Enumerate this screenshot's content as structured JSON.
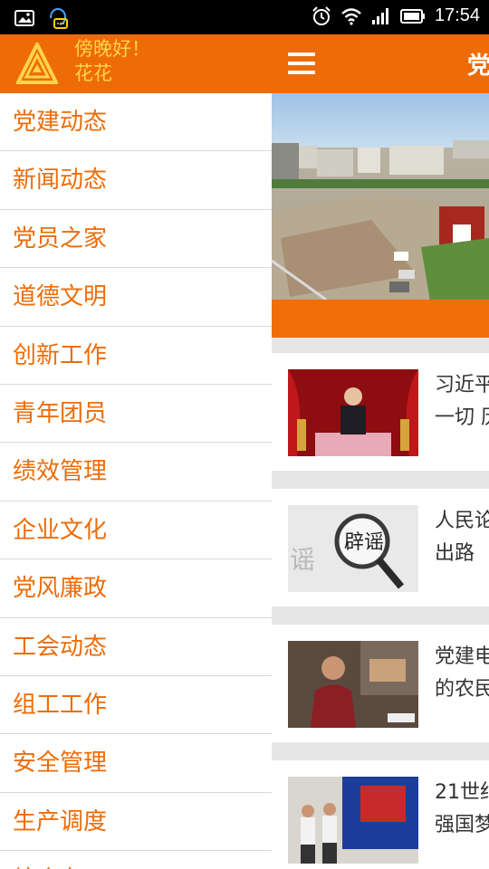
{
  "status_bar": {
    "time": "17:54",
    "icons": [
      "image-icon",
      "chat-bubble-icon",
      "alarm-icon",
      "wifi-icon",
      "signal-icon",
      "battery-icon"
    ]
  },
  "drawer": {
    "greeting_line1": "傍晚好！",
    "greeting_line2": "花花",
    "logo_icon": "triangle-logo-icon",
    "menu": [
      {
        "label": "党建动态"
      },
      {
        "label": "新闻动态"
      },
      {
        "label": "党员之家"
      },
      {
        "label": "道德文明"
      },
      {
        "label": "创新工作"
      },
      {
        "label": "青年团员"
      },
      {
        "label": "绩效管理"
      },
      {
        "label": "企业文化"
      },
      {
        "label": "党风廉政"
      },
      {
        "label": "工会动态"
      },
      {
        "label": "组工工作"
      },
      {
        "label": "安全管理"
      },
      {
        "label": "生产调度"
      },
      {
        "label": "综合办"
      }
    ]
  },
  "content": {
    "title": "党",
    "menu_icon": "hamburger-menu-icon",
    "news": [
      {
        "title": "习近平\n一切 历"
      },
      {
        "title": "人民论\n出路"
      },
      {
        "title": "党建电\n的农民"
      },
      {
        "title": "21世纪\n强国梦"
      }
    ]
  },
  "colors": {
    "brand_orange": "#ee6c07",
    "greeting_yellow": "#ffd44a",
    "menu_text": "#ee6c07"
  }
}
